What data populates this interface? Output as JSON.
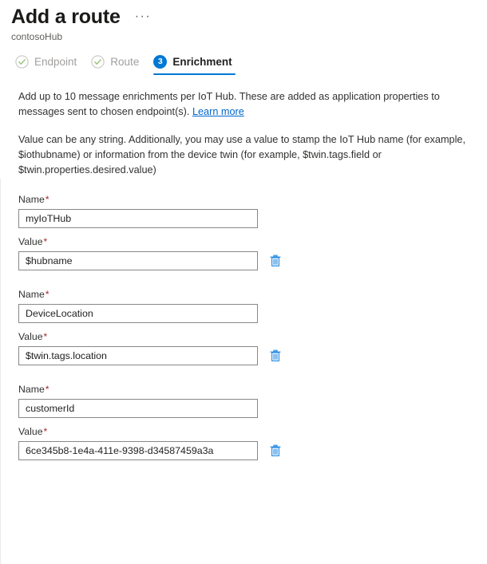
{
  "header": {
    "title": "Add a route",
    "more_menu": "···",
    "subtitle": "contosoHub"
  },
  "tabs": [
    {
      "label": "Endpoint",
      "state": "completed",
      "icon": "check-circle-icon"
    },
    {
      "label": "Route",
      "state": "completed",
      "icon": "check-circle-icon"
    },
    {
      "label": "Enrichment",
      "state": "active",
      "step": "3"
    }
  ],
  "descriptions": {
    "paragraph1_part1": "Add up to 10 message enrichments per IoT Hub. These are added as application properties to messages sent to chosen endpoint(s).",
    "learn_more": "Learn more",
    "paragraph2": "Value can be any string. Additionally, you may use a value to stamp the IoT Hub name (for example, $iothubname) or information from the device twin (for example, $twin.tags.field or $twin.properties.desired.value)"
  },
  "form": {
    "name_label": "Name",
    "value_label": "Value",
    "required_marker": "*",
    "delete_icon": "trash-icon",
    "enrichments": [
      {
        "name": "myIoTHub",
        "value": "$hubname"
      },
      {
        "name": "DeviceLocation",
        "value": "$twin.tags.location"
      },
      {
        "name": "customerId",
        "value": "6ce345b8-1e4a-411e-9398-d34587459a3a"
      }
    ]
  },
  "colors": {
    "accent": "#0078d4",
    "link": "#0066cc",
    "required": "#a4262c",
    "completed_check": "#8cbf6f",
    "text": "#323130",
    "muted": "#a19f9d"
  }
}
